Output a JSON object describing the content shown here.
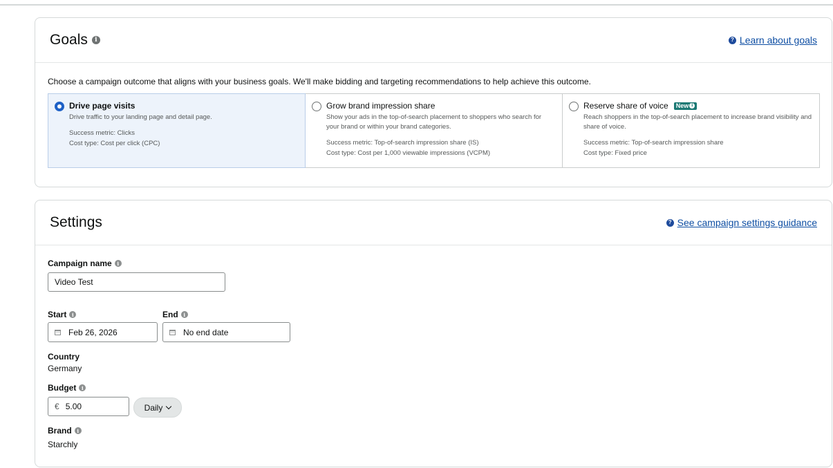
{
  "goals": {
    "title": "Goals",
    "learn_link": "Learn about goals",
    "description": "Choose a campaign outcome that aligns with your business goals. We'll make bidding and targeting recommendations to help achieve this outcome.",
    "options": [
      {
        "title": "Drive page visits",
        "description": "Drive traffic to your landing page and detail page.",
        "success_metric": "Success metric: Clicks",
        "cost_type": "Cost type: Cost per click (CPC)",
        "selected": true
      },
      {
        "title": "Grow brand impression share",
        "description": "Show your ads in the top-of-search placement to shoppers who search for your brand or within your brand categories.",
        "success_metric": "Success metric: Top-of-search impression share (IS)",
        "cost_type": "Cost type: Cost per 1,000 viewable impressions (VCPM)",
        "selected": false
      },
      {
        "title": "Reserve share of voice",
        "badge": "New",
        "description": "Reach shoppers in the top-of-search placement to increase brand visibility and share of voice.",
        "success_metric": "Success metric: Top-of-search impression share",
        "cost_type": "Cost type: Fixed price",
        "selected": false
      }
    ]
  },
  "settings": {
    "title": "Settings",
    "guidance_link": "See campaign settings guidance",
    "campaign_name_label": "Campaign name",
    "campaign_name_value": "Video Test",
    "start_label": "Start",
    "start_value": "Feb 26, 2026",
    "end_label": "End",
    "end_value": "No end date",
    "country_label": "Country",
    "country_value": "Germany",
    "budget_label": "Budget",
    "budget_currency": "€",
    "budget_value": "5.00",
    "budget_period": "Daily",
    "brand_label": "Brand",
    "brand_value": "Starchly"
  },
  "colors": {
    "link": "#0e4ea3",
    "selected_bg": "#edf3fb",
    "radio_selected": "#1e61c6",
    "badge_new": "#1a7873"
  }
}
